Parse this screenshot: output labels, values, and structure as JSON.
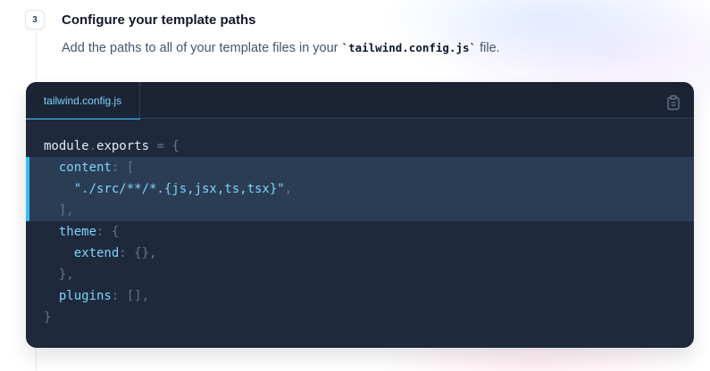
{
  "step": {
    "number": "3",
    "title": "Configure your template paths",
    "description_prefix": "Add the paths to all of your template files in your ",
    "description_code": "`tailwind.config.js`",
    "description_suffix": " file."
  },
  "code_window": {
    "tab_label": "tailwind.config.js",
    "copy_icon": "clipboard-icon",
    "colors": {
      "background": "#1e293b",
      "highlight": "#2b3d54",
      "accent": "#38bdf8",
      "key": "#7dd3fc",
      "punctuation": "#64748b"
    },
    "lines": {
      "l1": {
        "obj": "module",
        "dot": ".",
        "prop": "exports",
        "op": " = {"
      },
      "l2": {
        "indent": "  ",
        "key": "content",
        "punct": ": ["
      },
      "l3": {
        "indent": "    ",
        "str": "\"./src/**/*.{js,jsx,ts,tsx}\"",
        "punct": ","
      },
      "l4": {
        "indent": "  ",
        "punct": "],"
      },
      "l5": {
        "indent": "  ",
        "key": "theme",
        "punct": ": {"
      },
      "l6": {
        "indent": "    ",
        "key": "extend",
        "punct": ": {},"
      },
      "l7": {
        "indent": "  ",
        "punct": "},"
      },
      "l8": {
        "indent": "  ",
        "key": "plugins",
        "punct": ": [],"
      },
      "l9": {
        "punct": "}"
      }
    },
    "highlighted_lines": [
      2,
      3,
      4
    ]
  }
}
